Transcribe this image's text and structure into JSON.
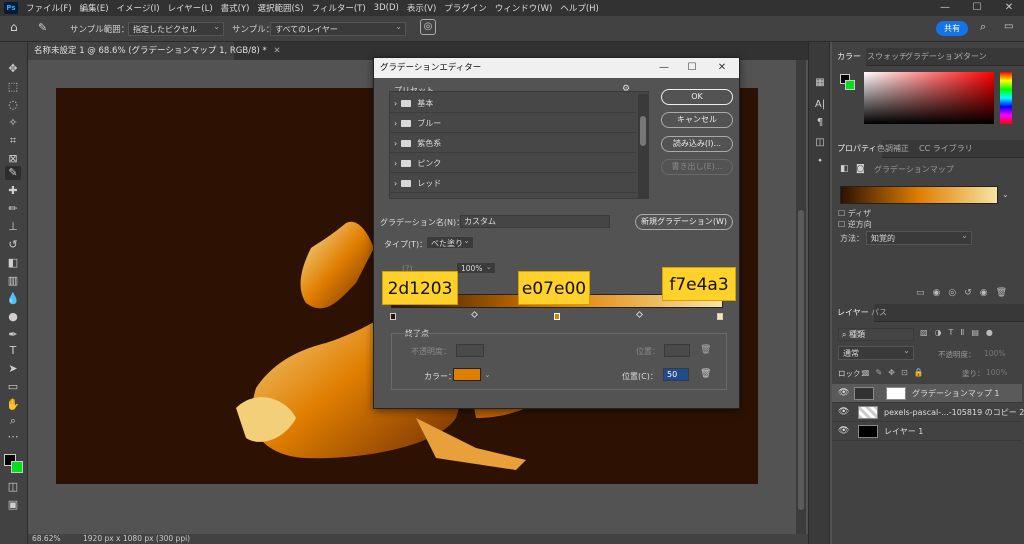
{
  "menubar": {
    "items": [
      "ファイル(F)",
      "編集(E)",
      "イメージ(I)",
      "レイヤー(L)",
      "書式(Y)",
      "選択範囲(S)",
      "フィルター(T)",
      "3D(D)",
      "表示(V)",
      "プラグイン",
      "ウィンドウ(W)",
      "ヘルプ(H)"
    ]
  },
  "options": {
    "sample_size_label": "サンプル範囲：",
    "sample_size_value": "指定したピクセル",
    "sample_label": "サンプル：",
    "sample_value": "すべてのレイヤー",
    "share_label": "共有"
  },
  "document": {
    "tab_title": "名称未設定 1 @ 68.6% (グラデーションマップ 1, RGB/8) *",
    "zoom": "68.62%",
    "status": "1920 px x 1080 px (300 ppi)"
  },
  "panels": {
    "color_tabs": [
      "カラー",
      "スウォッチ",
      "グラデーション",
      "パターン"
    ],
    "properties_tabs": [
      "プロパティ",
      "色調補正",
      "CC ライブラリ"
    ],
    "properties_title": "グラデーションマップ",
    "dither_label": "ディザ",
    "reverse_label": "逆方向",
    "method_label": "方法：",
    "method_value": "知覚的",
    "layers_tabs": [
      "レイヤー",
      "パス"
    ],
    "layers_search": "種類",
    "blend_mode": "通常",
    "opacity_label": "不透明度：",
    "opacity_value": "100%",
    "lock_label": "ロック：",
    "fill_label": "塗り：",
    "fill_value": "100%",
    "layers": [
      {
        "name": "グラデーションマップ 1"
      },
      {
        "name": "pexels-pascal-...-105819 のコピー 2"
      },
      {
        "name": "レイヤー 1"
      }
    ]
  },
  "dialog": {
    "title": "グラデーションエディター",
    "presets_label": "プリセット",
    "preset_folders": [
      "基本",
      "ブルー",
      "紫色系",
      "ピンク",
      "レッド"
    ],
    "ok": "OK",
    "cancel": "キャンセル",
    "load": "読み込み(I)...",
    "save": "書き出し(E)...",
    "name_label": "グラデーション名(N)：",
    "name_value": "カスタム",
    "new_button": "新規グラデーション(W)",
    "type_label": "タイプ(T)：",
    "type_value": "べた塗り",
    "smoothness_value": "100%",
    "stops_label": "終了点",
    "opacity_label": "不透明度：",
    "location_label": "位置：",
    "color_label": "カラー：",
    "color_location_label": "位置(C)：",
    "color_location_value": "50",
    "stop_colors": [
      "#2d1203",
      "#e07e00",
      "#f7e4a3"
    ],
    "stop_color_labels": [
      "2d1203",
      "e07e00",
      "f7e4a3"
    ],
    "selected_color": "#e07e00"
  }
}
